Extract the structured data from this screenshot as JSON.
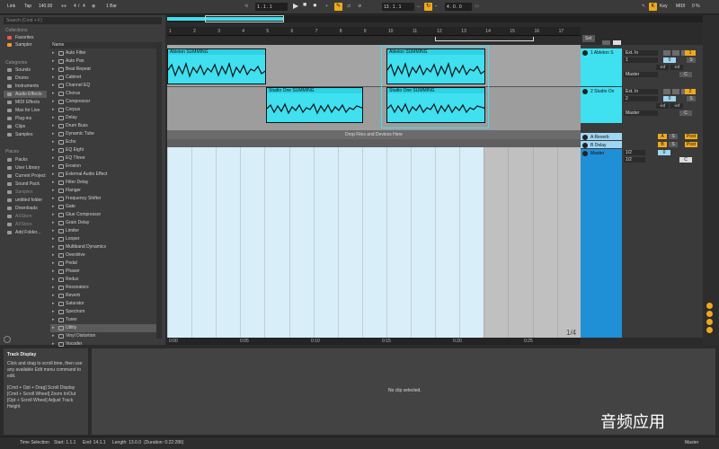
{
  "transport": {
    "link": "Link",
    "tap": "Tap",
    "tempo": "140.00",
    "sig_num": "4",
    "sig_den": "4",
    "bar": "1 Bar",
    "position": "1 .  1 .  1",
    "loop_start": "13 .  1 .  1",
    "loop_length": "4 .  0 .  0",
    "key": "Key",
    "midi": "MIDI",
    "cpu": "0 %"
  },
  "browser": {
    "search_placeholder": "Search (Cmd + F)",
    "collections_header": "Collections",
    "collections": [
      "Favorites",
      "Sampler"
    ],
    "categories_header": "Categories",
    "categories": [
      "Sounds",
      "Drums",
      "Instruments",
      "Audio Effects",
      "MIDI Effects",
      "Max for Live",
      "Plug-ins",
      "Clips",
      "Samples"
    ],
    "places_header": "Places",
    "places": [
      "Packs",
      "User Library",
      "Current Project",
      "Sound Pack",
      "Samples",
      "untitled folder",
      "Downloads",
      "AXStore",
      "AXStore",
      "Add Folder..."
    ],
    "name_header": "Name",
    "effects": [
      "Auto Filter",
      "Auto Pan",
      "Beat Repeat",
      "Cabinet",
      "Channel EQ",
      "Chorus",
      "Compressor",
      "Corpus",
      "Delay",
      "Drum Buss",
      "Dynamic Tube",
      "Echo",
      "EQ Eight",
      "EQ Three",
      "Erosion",
      "External Audio Effect",
      "Filter Delay",
      "Flanger",
      "Frequency Shifter",
      "Gate",
      "Glue Compressor",
      "Grain Delay",
      "Limiter",
      "Looper",
      "Multiband Dynamics",
      "Overdrive",
      "Pedal",
      "Phaser",
      "Redux",
      "Resonators",
      "Reverb",
      "Saturator",
      "Spectrum",
      "Tuner",
      "Utility",
      "Vinyl Distortion",
      "Vocoder"
    ]
  },
  "ruler": [
    "1",
    "2",
    "3",
    "4",
    "5",
    "6",
    "7",
    "8",
    "9",
    "10",
    "11",
    "12",
    "13",
    "14",
    "15",
    "16",
    "17"
  ],
  "clips": {
    "a1": "Ableton SUMMING",
    "a2": "Ableton SUMMING",
    "s1": "Studio One SUMMING",
    "s2": "Studio One SUMMING"
  },
  "drop_text": "Drop Files and Devices Here",
  "tracks": {
    "t1": {
      "name": "1 Ableton S",
      "input": "Ext. In",
      "ch": "1",
      "out": "Master",
      "vol": "-inf",
      "vol2": "-inf",
      "num": "1",
      "s": "S",
      "pan": "C",
      "zero": "0"
    },
    "t2": {
      "name": "2 Studio On",
      "input": "Ext. In",
      "ch": "2",
      "out": "Master",
      "vol": "-inf",
      "vol2": "-inf",
      "num": "2",
      "s": "S",
      "pan": "C",
      "zero": "0"
    },
    "ra": {
      "name": "A Reverb",
      "letter": "A",
      "s": "S",
      "post": "Post"
    },
    "rb": {
      "name": "B Delay",
      "letter": "B",
      "s": "S",
      "post": "Post"
    },
    "master": {
      "name": "Master",
      "o1": "1/2",
      "o2": "1/2",
      "zero": "0",
      "pan": "C"
    },
    "set_label": "Set"
  },
  "time_ruler": [
    "0:00",
    "0:05",
    "0:10",
    "0:15",
    "0:20",
    "0:25"
  ],
  "zoom_label": "1/4",
  "info": {
    "title": "Track Display",
    "body": "Click and drag to scroll time, then use any available Edit menu command to edit.",
    "hint1": "[Cmd + Opt + Drag] Scroll Display",
    "hint2": "[Cmd + Scroll Wheel] Zoom In/Out",
    "hint3": "[Opt + Scroll Wheel] Adjust Track Height"
  },
  "detail_text": "No clip selected.",
  "status": {
    "label": "Time Selection",
    "start": "Start: 1.1.1",
    "end": "End: 14.1.1",
    "length": "Length: 13.0.0",
    "duration": "(Duration: 0:22:286)",
    "output": "Master"
  },
  "watermark": "音频应用",
  "colors": {
    "clip": "#3fe0f0",
    "accent": "#f0a91c",
    "selection": "#d8eef8"
  }
}
